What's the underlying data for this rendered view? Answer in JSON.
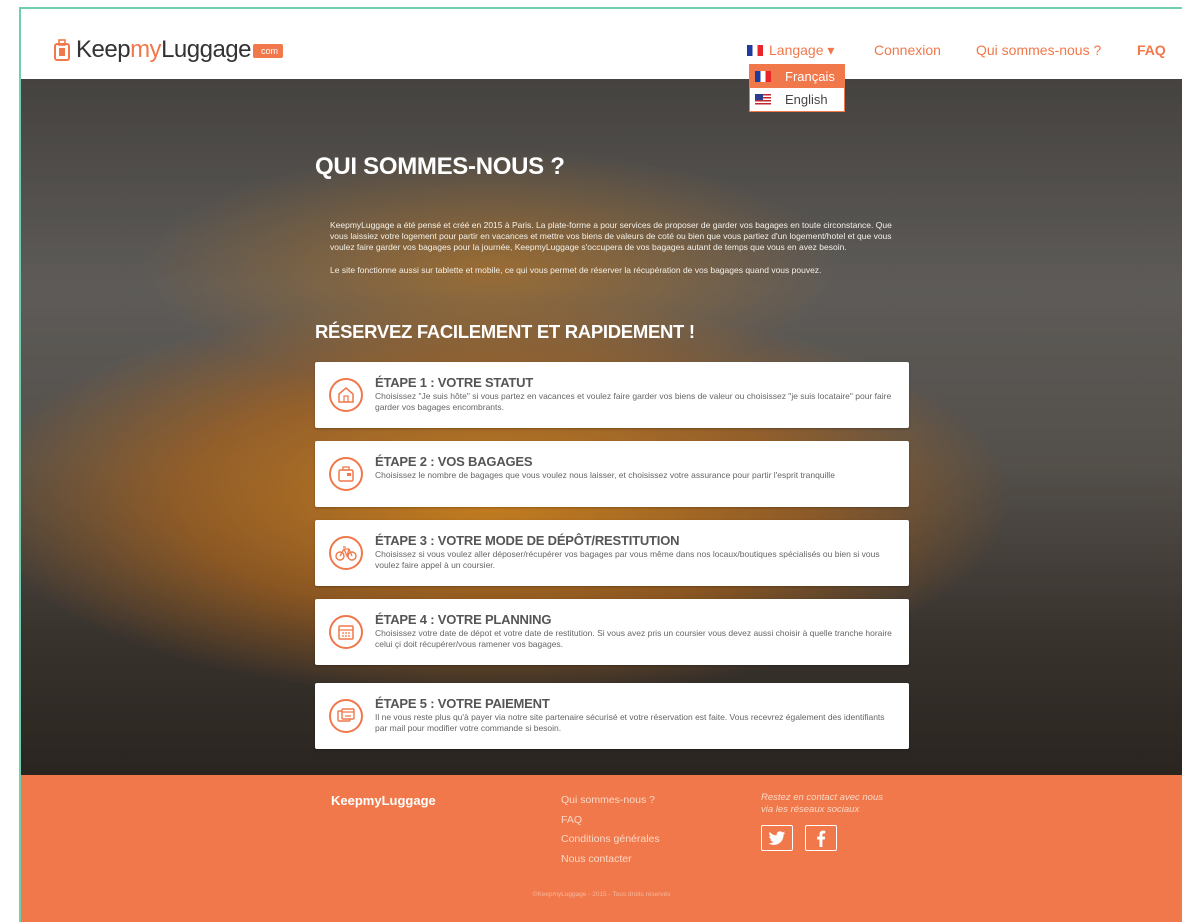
{
  "header": {
    "logo": {
      "text_1": "Keep",
      "text_2": "my",
      "text_3": "Luggage",
      "badge": "com"
    },
    "nav": {
      "language_label": "Langage ▾",
      "login": "Connexion",
      "about": "Qui sommes-nous ?",
      "faq": "FAQ"
    },
    "language_menu": [
      {
        "label": "Français",
        "flag": "flag-fr-icon",
        "active": true
      },
      {
        "label": "English",
        "flag": "flag-us-icon",
        "active": false
      }
    ]
  },
  "hero": {
    "title": "QUI SOMMES-NOUS ?",
    "intro_paragraph_1": "KeepmyLuggage a été pensé et créé en 2015 à Paris. La plate-forme a pour services de proposer de garder vos bagages en toute circonstance. Que vous laissiez votre logement pour partir en vacances et mettre vos biens de valeurs de coté ou bien que vous partiez d'un logement/hotel et que vous voulez faire garder vos bagages pour la journée, KeepmyLuggage s'occupera de vos bagages autant de temps que vous en avez besoin.",
    "intro_paragraph_2": "Le site fonctionne aussi sur tablette et mobile, ce qui vous permet de réserver la récupération de vos bagages quand vous pouvez.",
    "steps_title": "RÉSERVEZ FACILEMENT ET RAPIDEMENT !",
    "steps": [
      {
        "title": "ÉTAPE 1 : VOTRE STATUT",
        "icon": "house-icon",
        "description": "Choisissez \"Je suis hôte\" si vous partez en vacances et voulez faire garder vos biens de valeur ou choisissez \"je suis locataire\" pour faire garder vos bagages encombrants."
      },
      {
        "title": "ÉTAPE 2 : VOS BAGAGES",
        "icon": "luggage-icon",
        "description": "Choisissez le nombre de bagages que vous voulez nous laisser, et choisissez votre assurance pour partir l'esprit tranquille"
      },
      {
        "title": "ÉTAPE 3 : VOTRE MODE DE DÉPÔT/RESTITUTION",
        "icon": "bicycle-icon",
        "description": "Choisissez si vous voulez aller déposer/récupérer vos bagages par vous même dans nos locaux/boutiques spécialisés ou bien si vous voulez faire appel à un coursier."
      },
      {
        "title": "ÉTAPE 4 : VOTRE PLANNING",
        "icon": "calendar-icon",
        "description": "Choisissez votre date de dépot et votre date de restitution. Si vous avez pris un coursier vous devez aussi choisir à quelle tranche horaire celui çi doit récupérer/vous ramener vos bagages."
      },
      {
        "title": "ÉTAPE 5 : VOTRE PAIEMENT",
        "icon": "credit-card-icon",
        "description": "Il ne vous reste plus qu'à payer via notre site partenaire sécurisé et votre réservation est faite. Vous recevrez également des identifiants par mail pour modifier votre commande si besoin."
      }
    ]
  },
  "footer": {
    "brand": "KeepmyLuggage",
    "links": [
      "Qui sommes-nous ?",
      "FAQ",
      "Conditions générales",
      "Nous contacter"
    ],
    "social_text_1": "Restez en contact avec nous",
    "social_text_2": "via les réseaux sociaux",
    "social_icons": [
      "twitter-icon",
      "facebook-icon"
    ],
    "copyright": "©KeepmyLuggage - 2015 - Tous droits réservés"
  },
  "colors": {
    "accent": "#f0784b",
    "frame": "#6fcfae"
  }
}
